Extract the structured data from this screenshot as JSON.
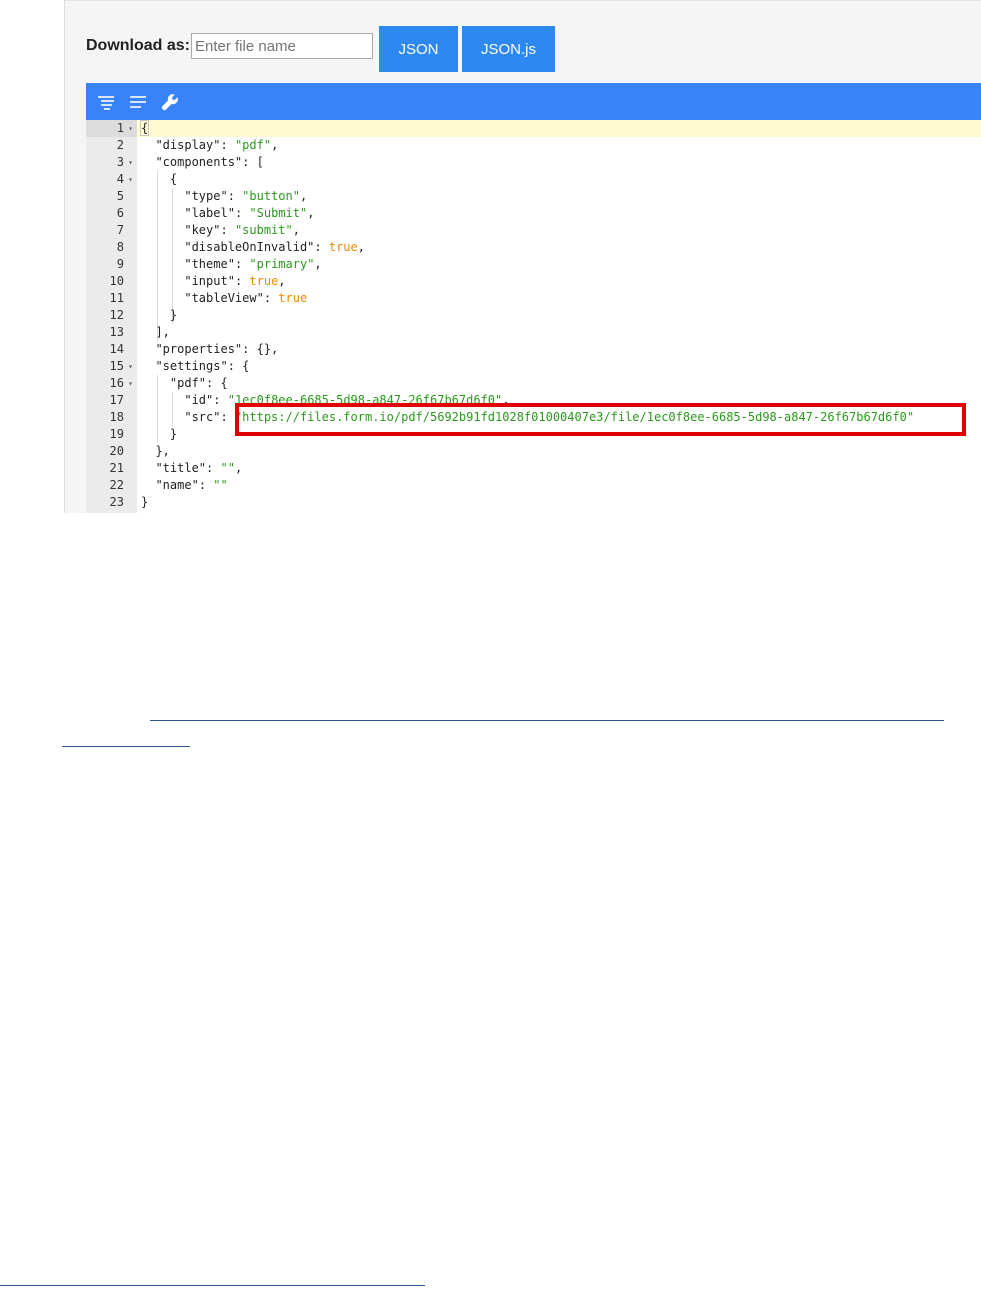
{
  "download": {
    "label": "Download as:",
    "placeholder": "Enter file name",
    "json_button": "JSON",
    "jsonjs_button": "JSON.js"
  },
  "toolbar": {
    "icons": [
      "format-icon",
      "compact-icon",
      "repair-icon"
    ]
  },
  "editor": {
    "lines": [
      {
        "num": "1",
        "fold": true
      },
      {
        "num": "2"
      },
      {
        "num": "3",
        "fold": true
      },
      {
        "num": "4",
        "fold": true
      },
      {
        "num": "5"
      },
      {
        "num": "6"
      },
      {
        "num": "7"
      },
      {
        "num": "8"
      },
      {
        "num": "9"
      },
      {
        "num": "10"
      },
      {
        "num": "11"
      },
      {
        "num": "12"
      },
      {
        "num": "13"
      },
      {
        "num": "14"
      },
      {
        "num": "15",
        "fold": true
      },
      {
        "num": "16",
        "fold": true
      },
      {
        "num": "17"
      },
      {
        "num": "18"
      },
      {
        "num": "19"
      },
      {
        "num": "20"
      },
      {
        "num": "21"
      },
      {
        "num": "22"
      },
      {
        "num": "23"
      }
    ],
    "text": {
      "l2_key": "\"display\"",
      "l2_val": "\"pdf\"",
      "l3_key": "\"components\"",
      "l5_key": "\"type\"",
      "l5_val": "\"button\"",
      "l6_key": "\"label\"",
      "l6_val": "\"Submit\"",
      "l7_key": "\"key\"",
      "l7_val": "\"submit\"",
      "l8_key": "\"disableOnInvalid\"",
      "l8_val": "true",
      "l9_key": "\"theme\"",
      "l9_val": "\"primary\"",
      "l10_key": "\"input\"",
      "l10_val": "true",
      "l11_key": "\"tableView\"",
      "l11_val": "true",
      "l14_key": "\"properties\"",
      "l15_key": "\"settings\"",
      "l16_key": "\"pdf\"",
      "l17_key": "\"id\"",
      "l17_val": "\"1ec0f8ee-6685-5d98-a847-26f67b67d6f0\"",
      "l18_key": "\"src\"",
      "l18_val": "\"https://files.form.io/pdf/5692b91fd1028f01000407e3/file/1ec0f8ee-6685-5d98-a847-26f67b67d6f0\"",
      "l21_key": "\"title\"",
      "l21_val": "\"\"",
      "l22_key": "\"name\"",
      "l22_val": "\"\""
    }
  },
  "colors": {
    "toolbar": "#3883fa",
    "button": "#2d89ef",
    "string": "#2a9a1b",
    "boolean": "#ec8a00",
    "highlight_border": "#e00000"
  }
}
